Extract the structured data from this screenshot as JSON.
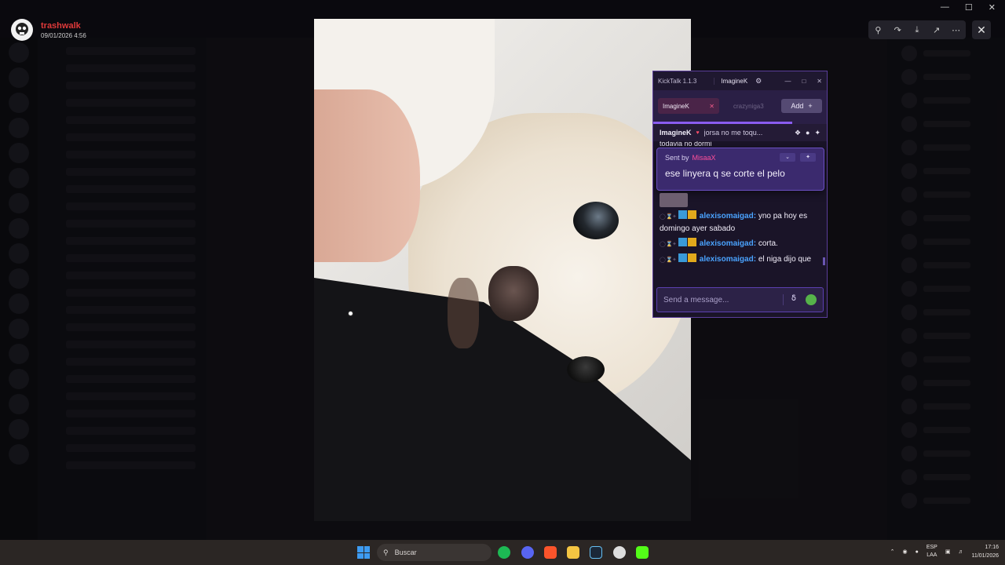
{
  "viewer": {
    "username": "trashwalk",
    "timestamp": "09/01/2026 4:56",
    "tools": [
      "zoom-icon",
      "share-icon",
      "download-icon",
      "open-external-icon",
      "more-icon"
    ]
  },
  "kicktalk": {
    "app_title": "KickTalk 1.1.3",
    "user": "ImagineK",
    "tabs": [
      {
        "label": "ImagineK",
        "active": true
      },
      {
        "label": "crazyniga3",
        "active": false
      }
    ],
    "add_label": "Add",
    "pinned": {
      "user": "ImagineK",
      "message": "jorsa no me toqu..."
    },
    "partial_line": "todavia no dormi",
    "reply_card": {
      "sent_by_label": "Sent by",
      "sender": "MisaaX",
      "message": "ese linyera q se corte el pelo"
    },
    "messages": [
      {
        "user": "alexisomaigad:",
        "text": "yno pa hoy es domingo ayer sabado"
      },
      {
        "user": "alexisomaigad:",
        "text": "corta."
      },
      {
        "user": "alexisomaigad:",
        "text": "el niga dijo que hoy pones la serie de ted"
      }
    ],
    "input_placeholder": "Send a message..."
  },
  "taskbar": {
    "search_label": "Buscar",
    "lang_top": "ESP",
    "lang_bottom": "LAA",
    "time": "17:16",
    "date": "11/01/2026",
    "apps": [
      "spotify-icon",
      "discord-icon",
      "brave-icon",
      "file-explorer-icon",
      "steam-icon",
      "chrome-icon",
      "kick-icon"
    ]
  },
  "colors": {
    "kick_purple": "#5a3d9a",
    "username_red": "#e03a3a",
    "chat_name_blue": "#4aa3ff",
    "sender_pink": "#ff4f9a"
  }
}
